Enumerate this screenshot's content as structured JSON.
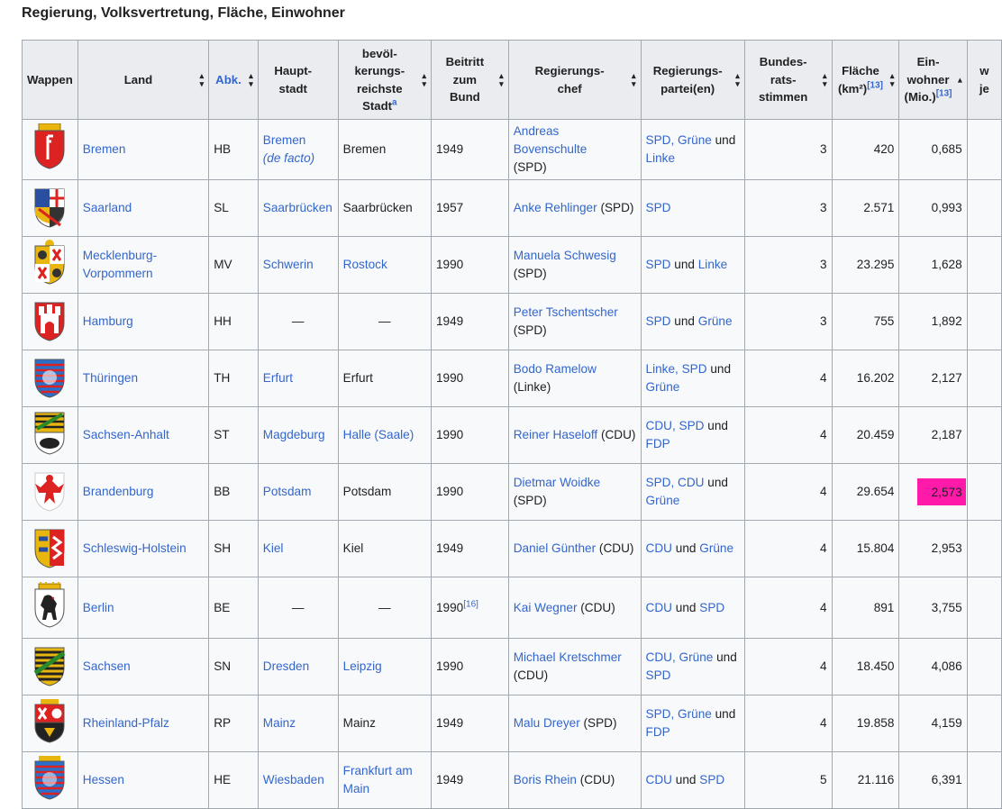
{
  "heading": "Regierung, Volksvertretung, Fläche, Einwohner",
  "headers": {
    "wappen": "Wappen",
    "land": "Land",
    "abk": "Abk.",
    "hauptstadt": "Haupt-stadt",
    "stadt": "bevöl-kerungs-reichste Stadt",
    "stadt_note": "a",
    "beitritt": "Beitritt zum Bund",
    "chef": "Regierungs-chef",
    "partei": "Regierungs-partei(en)",
    "stimmen": "Bundes-rats-stimmen",
    "flaeche": "Fläche (km²)",
    "flaeche_ref": "[13]",
    "einwohner": "Ein-wohner (Mio.)",
    "einwohner_ref": "[13]",
    "next": "w je"
  },
  "colors": {
    "link": "#3366cc",
    "highlight": "#ff1aaa",
    "header_bg": "#eaecf0",
    "row_bg": "#f8f9fa"
  },
  "conj": "und",
  "rows": [
    {
      "land": "Bremen",
      "abk": "HB",
      "haupt": "Bremen",
      "haupt_note": "(de facto)",
      "stadt": "Bremen",
      "stadt_link": false,
      "beitritt": "1949",
      "beitritt_ref": "",
      "chef": "Andreas Bovenschulte",
      "chef_party": "(SPD)",
      "chef_wrap": true,
      "parteien": [
        "SPD, Grüne",
        "Linke"
      ],
      "stimmen": "3",
      "flaeche": "420",
      "einwohner": "0,685",
      "crest": "bremen"
    },
    {
      "land": "Saarland",
      "abk": "SL",
      "haupt": "Saarbrücken",
      "haupt_note": "",
      "stadt": "Saarbrücken",
      "stadt_link": false,
      "beitritt": "1957",
      "beitritt_ref": "",
      "chef": "Anke Rehlinger",
      "chef_party": "(SPD)",
      "chef_wrap": false,
      "parteien": [
        "SPD"
      ],
      "stimmen": "3",
      "flaeche": "2.571",
      "einwohner": "0,993",
      "crest": "saarland"
    },
    {
      "land": "Mecklenburg-Vorpommern",
      "abk": "MV",
      "haupt": "Schwerin",
      "haupt_note": "",
      "stadt": "Rostock",
      "stadt_link": true,
      "beitritt": "1990",
      "beitritt_ref": "",
      "chef": "Manuela Schwesig",
      "chef_party": "(SPD)",
      "chef_wrap": true,
      "parteien": [
        "SPD",
        "Linke"
      ],
      "stimmen": "3",
      "flaeche": "23.295",
      "einwohner": "1,628",
      "crest": "mv"
    },
    {
      "land": "Hamburg",
      "abk": "HH",
      "haupt": "—",
      "haupt_note": "",
      "stadt": "—",
      "stadt_link": false,
      "beitritt": "1949",
      "beitritt_ref": "",
      "chef": "Peter Tschentscher",
      "chef_party": "(SPD)",
      "chef_wrap": true,
      "parteien": [
        "SPD",
        "Grüne"
      ],
      "stimmen": "3",
      "flaeche": "755",
      "einwohner": "1,892",
      "crest": "hamburg"
    },
    {
      "land": "Thüringen",
      "abk": "TH",
      "haupt": "Erfurt",
      "haupt_note": "",
      "stadt": "Erfurt",
      "stadt_link": false,
      "beitritt": "1990",
      "beitritt_ref": "",
      "chef": "Bodo Ramelow",
      "chef_party": "(Linke)",
      "chef_wrap": false,
      "parteien": [
        "Linke, SPD",
        "Grüne"
      ],
      "stimmen": "4",
      "flaeche": "16.202",
      "einwohner": "2,127",
      "crest": "thueringen"
    },
    {
      "land": "Sachsen-Anhalt",
      "abk": "ST",
      "haupt": "Magdeburg",
      "haupt_note": "",
      "stadt": "Halle (Saale)",
      "stadt_link": true,
      "beitritt": "1990",
      "beitritt_ref": "",
      "chef": "Reiner Haseloff",
      "chef_party": "(CDU)",
      "chef_wrap": false,
      "parteien": [
        "CDU, SPD",
        "FDP"
      ],
      "stimmen": "4",
      "flaeche": "20.459",
      "einwohner": "2,187",
      "crest": "sa"
    },
    {
      "land": "Brandenburg",
      "abk": "BB",
      "haupt": "Potsdam",
      "haupt_note": "",
      "stadt": "Potsdam",
      "stadt_link": false,
      "beitritt": "1990",
      "beitritt_ref": "",
      "chef": "Dietmar Woidke",
      "chef_party": "(SPD)",
      "chef_wrap": false,
      "parteien": [
        "SPD, CDU",
        "Grüne"
      ],
      "stimmen": "4",
      "flaeche": "29.654",
      "einwohner": "2,573",
      "crest": "brandenburg",
      "highlight": true
    },
    {
      "land": "Schleswig-Holstein",
      "abk": "SH",
      "haupt": "Kiel",
      "haupt_note": "",
      "stadt": "Kiel",
      "stadt_link": false,
      "beitritt": "1949",
      "beitritt_ref": "",
      "chef": "Daniel Günther",
      "chef_party": "(CDU)",
      "chef_wrap": false,
      "parteien": [
        "CDU",
        "Grüne"
      ],
      "stimmen": "4",
      "flaeche": "15.804",
      "einwohner": "2,953",
      "crest": "sh"
    },
    {
      "land": "Berlin",
      "abk": "BE",
      "haupt": "—",
      "haupt_note": "",
      "stadt": "—",
      "stadt_link": false,
      "beitritt": "1990",
      "beitritt_ref": "[16]",
      "chef": "Kai Wegner",
      "chef_party": "(CDU)",
      "chef_wrap": false,
      "parteien": [
        "CDU",
        "SPD"
      ],
      "stimmen": "4",
      "flaeche": "891",
      "einwohner": "3,755",
      "crest": "berlin"
    },
    {
      "land": "Sachsen",
      "abk": "SN",
      "haupt": "Dresden",
      "haupt_note": "",
      "stadt": "Leipzig",
      "stadt_link": true,
      "beitritt": "1990",
      "beitritt_ref": "",
      "chef": "Michael Kretschmer",
      "chef_party": "(CDU)",
      "chef_wrap": true,
      "parteien": [
        "CDU, Grüne",
        "SPD"
      ],
      "stimmen": "4",
      "flaeche": "18.450",
      "einwohner": "4,086",
      "crest": "sachsen"
    },
    {
      "land": "Rheinland-Pfalz",
      "abk": "RP",
      "haupt": "Mainz",
      "haupt_note": "",
      "stadt": "Mainz",
      "stadt_link": false,
      "beitritt": "1949",
      "beitritt_ref": "",
      "chef": "Malu Dreyer",
      "chef_party": "(SPD)",
      "chef_wrap": false,
      "parteien": [
        "SPD, Grüne",
        "FDP"
      ],
      "stimmen": "4",
      "flaeche": "19.858",
      "einwohner": "4,159",
      "crest": "rp"
    },
    {
      "land": "Hessen",
      "abk": "HE",
      "haupt": "Wiesbaden",
      "haupt_note": "",
      "stadt": "Frankfurt am Main",
      "stadt_link": true,
      "beitritt": "1949",
      "beitritt_ref": "",
      "chef": "Boris Rhein",
      "chef_party": "(CDU)",
      "chef_wrap": false,
      "parteien": [
        "CDU",
        "SPD"
      ],
      "stimmen": "5",
      "flaeche": "21.116",
      "einwohner": "6,391",
      "crest": "hessen"
    }
  ]
}
